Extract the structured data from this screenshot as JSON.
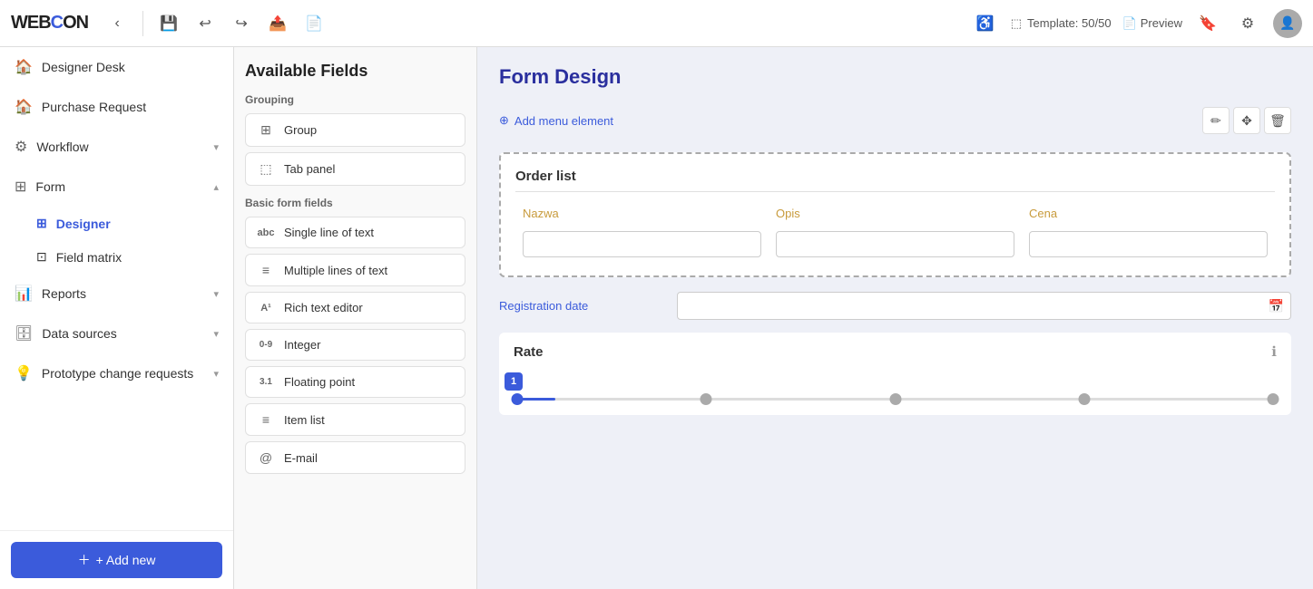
{
  "app": {
    "logo": "WEBCON",
    "logo_accent": "O"
  },
  "toolbar": {
    "template_label": "Template: 50/50",
    "preview_label": "Preview"
  },
  "sidebar": {
    "items": [
      {
        "id": "designer-desk",
        "label": "Designer Desk",
        "icon": "🏠",
        "level": 0,
        "expandable": false
      },
      {
        "id": "purchase-request",
        "label": "Purchase Request",
        "icon": "🏠",
        "level": 0,
        "expandable": false
      },
      {
        "id": "workflow",
        "label": "Workflow",
        "icon": "⚙",
        "level": 0,
        "expandable": true
      },
      {
        "id": "form",
        "label": "Form",
        "icon": "⊞",
        "level": 0,
        "expandable": true,
        "expanded": true
      },
      {
        "id": "designer",
        "label": "Designer",
        "icon": "⊞",
        "level": 1,
        "active": true
      },
      {
        "id": "field-matrix",
        "label": "Field matrix",
        "icon": "⊡",
        "level": 1
      },
      {
        "id": "reports",
        "label": "Reports",
        "icon": "📊",
        "level": 0,
        "expandable": true
      },
      {
        "id": "data-sources",
        "label": "Data sources",
        "icon": "🗄",
        "level": 0,
        "expandable": true
      },
      {
        "id": "prototype-change",
        "label": "Prototype change requests",
        "icon": "💡",
        "level": 0,
        "expandable": true
      }
    ],
    "add_new_label": "+ Add new"
  },
  "fields_panel": {
    "title": "Available Fields",
    "grouping_section": "Grouping",
    "grouping_items": [
      {
        "id": "group",
        "label": "Group",
        "icon": "⊞"
      },
      {
        "id": "tab-panel",
        "label": "Tab panel",
        "icon": "⬚"
      }
    ],
    "basic_section": "Basic form fields",
    "basic_items": [
      {
        "id": "single-line",
        "label": "Single line of text",
        "icon": "abc"
      },
      {
        "id": "multi-line",
        "label": "Multiple lines of text",
        "icon": "≡"
      },
      {
        "id": "rich-text",
        "label": "Rich text editor",
        "icon": "A¹"
      },
      {
        "id": "integer",
        "label": "Integer",
        "icon": "0-9"
      },
      {
        "id": "floating-point",
        "label": "Floating point",
        "icon": "3.1"
      },
      {
        "id": "item-list",
        "label": "Item list",
        "icon": "≡"
      },
      {
        "id": "email",
        "label": "E-mail",
        "icon": "@"
      }
    ]
  },
  "form": {
    "title": "Form Design",
    "add_menu_label": "Add menu element",
    "order_list": {
      "group_name": "Order list",
      "columns": [
        "Nazwa",
        "Opis",
        "Cena"
      ]
    },
    "registration_date": {
      "label": "Registration date"
    },
    "rate": {
      "label": "Rate",
      "value": 1,
      "slider_markers": [
        0,
        25,
        50,
        75,
        100
      ]
    }
  }
}
